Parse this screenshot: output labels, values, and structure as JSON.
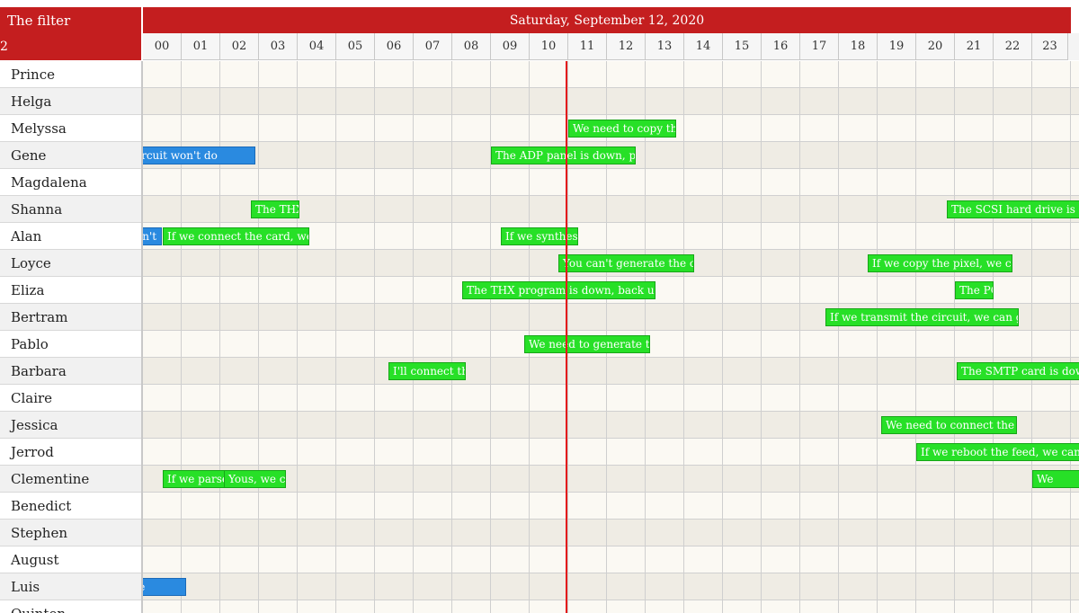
{
  "toolbar": {
    "filter_label": "The filter",
    "filter_fragment": "2"
  },
  "header": {
    "date_label": "Saturday, September 12, 2020",
    "hours": [
      "00",
      "01",
      "02",
      "03",
      "04",
      "05",
      "06",
      "07",
      "08",
      "09",
      "10",
      "11",
      "12",
      "13",
      "14",
      "15",
      "16",
      "17",
      "18",
      "19",
      "20",
      "21",
      "22",
      "23"
    ]
  },
  "colors": {
    "header_red": "#c41e1f",
    "now_line": "#e41b1b",
    "event_green": "#27e027",
    "event_blue": "#2a8ae0"
  },
  "resources": [
    "Prince",
    "Helga",
    "Melyssa",
    "Gene",
    "Magdalena",
    "Shanna",
    "Alan",
    "Loyce",
    "Eliza",
    "Bertram",
    "Pablo",
    "Barbara",
    "Claire",
    "Jessica",
    "Jerrod",
    "Clementine",
    "Benedict",
    "Stephen",
    "August",
    "Luis",
    "Quinton"
  ],
  "current_time_hour": 11,
  "events": [
    {
      "row": 2,
      "start": 11.0,
      "end": 13.8,
      "text": "We need to copy the",
      "color": "green"
    },
    {
      "row": 3,
      "start": -1.5,
      "end": 2.9,
      "text": "ing the circuit won't do",
      "color": "blue"
    },
    {
      "row": 3,
      "start": 9.0,
      "end": 12.75,
      "text": "The ADP panel is down, parse",
      "color": "green"
    },
    {
      "row": 5,
      "start": 2.8,
      "end": 4.05,
      "text": "The THX",
      "color": "green"
    },
    {
      "row": 5,
      "start": 20.8,
      "end": 24.8,
      "text": "The SCSI hard drive is down",
      "color": "green"
    },
    {
      "row": 6,
      "start": -0.3,
      "end": 0.5,
      "text": "on't",
      "color": "blue"
    },
    {
      "row": 6,
      "start": 0.5,
      "end": 4.3,
      "text": "If we connect the card, we can se",
      "color": "green"
    },
    {
      "row": 6,
      "start": 9.25,
      "end": 11.25,
      "text": "If we synthesize",
      "color": "green"
    },
    {
      "row": 7,
      "start": 10.75,
      "end": 14.25,
      "text": "You can't generate the circuit",
      "color": "green"
    },
    {
      "row": 7,
      "start": 18.75,
      "end": 22.5,
      "text": "If we copy the pixel, we can get",
      "color": "green"
    },
    {
      "row": 8,
      "start": 8.25,
      "end": 13.25,
      "text": "The THX program is down, back up the",
      "color": "green"
    },
    {
      "row": 8,
      "start": 21.0,
      "end": 22.0,
      "text": "The PCI",
      "color": "green"
    },
    {
      "row": 9,
      "start": 17.65,
      "end": 22.65,
      "text": "If we transmit the circuit, we can get to the",
      "color": "green"
    },
    {
      "row": 10,
      "start": 9.85,
      "end": 13.1,
      "text": "We need to generate the",
      "color": "green"
    },
    {
      "row": 11,
      "start": 6.35,
      "end": 8.35,
      "text": "I'll connect the",
      "color": "green"
    },
    {
      "row": 11,
      "start": 21.05,
      "end": 24.8,
      "text": "The SMTP card is down,",
      "color": "green"
    },
    {
      "row": 13,
      "start": 19.1,
      "end": 22.6,
      "text": "We need to connect the",
      "color": "green"
    },
    {
      "row": 14,
      "start": 20.0,
      "end": 24.8,
      "text": "If we reboot the feed, we can get to",
      "color": "green"
    },
    {
      "row": 15,
      "start": 0.5,
      "end": 2.1,
      "text": "If we parse th",
      "color": "green"
    },
    {
      "row": 15,
      "start": 2.1,
      "end": 3.7,
      "text": "Yous, we can",
      "color": "green"
    },
    {
      "row": 15,
      "start": 23.0,
      "end": 24.8,
      "text": "We",
      "color": "green"
    },
    {
      "row": 19,
      "start": -1.5,
      "end": 1.1,
      "text": "ecting the",
      "color": "blue"
    }
  ]
}
